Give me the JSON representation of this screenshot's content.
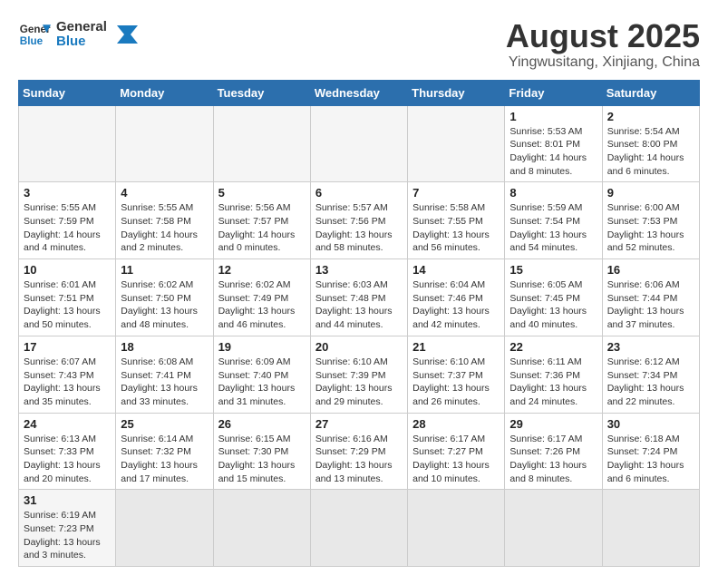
{
  "header": {
    "logo_text_general": "General",
    "logo_text_blue": "Blue",
    "month_title": "August 2025",
    "location": "Yingwusitang, Xinjiang, China"
  },
  "days_of_week": [
    "Sunday",
    "Monday",
    "Tuesday",
    "Wednesday",
    "Thursday",
    "Friday",
    "Saturday"
  ],
  "weeks": [
    {
      "days": [
        {
          "num": "",
          "info": ""
        },
        {
          "num": "",
          "info": ""
        },
        {
          "num": "",
          "info": ""
        },
        {
          "num": "",
          "info": ""
        },
        {
          "num": "",
          "info": ""
        },
        {
          "num": "1",
          "info": "Sunrise: 5:53 AM\nSunset: 8:01 PM\nDaylight: 14 hours and 8 minutes."
        },
        {
          "num": "2",
          "info": "Sunrise: 5:54 AM\nSunset: 8:00 PM\nDaylight: 14 hours and 6 minutes."
        }
      ]
    },
    {
      "days": [
        {
          "num": "3",
          "info": "Sunrise: 5:55 AM\nSunset: 7:59 PM\nDaylight: 14 hours and 4 minutes."
        },
        {
          "num": "4",
          "info": "Sunrise: 5:55 AM\nSunset: 7:58 PM\nDaylight: 14 hours and 2 minutes."
        },
        {
          "num": "5",
          "info": "Sunrise: 5:56 AM\nSunset: 7:57 PM\nDaylight: 14 hours and 0 minutes."
        },
        {
          "num": "6",
          "info": "Sunrise: 5:57 AM\nSunset: 7:56 PM\nDaylight: 13 hours and 58 minutes."
        },
        {
          "num": "7",
          "info": "Sunrise: 5:58 AM\nSunset: 7:55 PM\nDaylight: 13 hours and 56 minutes."
        },
        {
          "num": "8",
          "info": "Sunrise: 5:59 AM\nSunset: 7:54 PM\nDaylight: 13 hours and 54 minutes."
        },
        {
          "num": "9",
          "info": "Sunrise: 6:00 AM\nSunset: 7:53 PM\nDaylight: 13 hours and 52 minutes."
        }
      ]
    },
    {
      "days": [
        {
          "num": "10",
          "info": "Sunrise: 6:01 AM\nSunset: 7:51 PM\nDaylight: 13 hours and 50 minutes."
        },
        {
          "num": "11",
          "info": "Sunrise: 6:02 AM\nSunset: 7:50 PM\nDaylight: 13 hours and 48 minutes."
        },
        {
          "num": "12",
          "info": "Sunrise: 6:02 AM\nSunset: 7:49 PM\nDaylight: 13 hours and 46 minutes."
        },
        {
          "num": "13",
          "info": "Sunrise: 6:03 AM\nSunset: 7:48 PM\nDaylight: 13 hours and 44 minutes."
        },
        {
          "num": "14",
          "info": "Sunrise: 6:04 AM\nSunset: 7:46 PM\nDaylight: 13 hours and 42 minutes."
        },
        {
          "num": "15",
          "info": "Sunrise: 6:05 AM\nSunset: 7:45 PM\nDaylight: 13 hours and 40 minutes."
        },
        {
          "num": "16",
          "info": "Sunrise: 6:06 AM\nSunset: 7:44 PM\nDaylight: 13 hours and 37 minutes."
        }
      ]
    },
    {
      "days": [
        {
          "num": "17",
          "info": "Sunrise: 6:07 AM\nSunset: 7:43 PM\nDaylight: 13 hours and 35 minutes."
        },
        {
          "num": "18",
          "info": "Sunrise: 6:08 AM\nSunset: 7:41 PM\nDaylight: 13 hours and 33 minutes."
        },
        {
          "num": "19",
          "info": "Sunrise: 6:09 AM\nSunset: 7:40 PM\nDaylight: 13 hours and 31 minutes."
        },
        {
          "num": "20",
          "info": "Sunrise: 6:10 AM\nSunset: 7:39 PM\nDaylight: 13 hours and 29 minutes."
        },
        {
          "num": "21",
          "info": "Sunrise: 6:10 AM\nSunset: 7:37 PM\nDaylight: 13 hours and 26 minutes."
        },
        {
          "num": "22",
          "info": "Sunrise: 6:11 AM\nSunset: 7:36 PM\nDaylight: 13 hours and 24 minutes."
        },
        {
          "num": "23",
          "info": "Sunrise: 6:12 AM\nSunset: 7:34 PM\nDaylight: 13 hours and 22 minutes."
        }
      ]
    },
    {
      "days": [
        {
          "num": "24",
          "info": "Sunrise: 6:13 AM\nSunset: 7:33 PM\nDaylight: 13 hours and 20 minutes."
        },
        {
          "num": "25",
          "info": "Sunrise: 6:14 AM\nSunset: 7:32 PM\nDaylight: 13 hours and 17 minutes."
        },
        {
          "num": "26",
          "info": "Sunrise: 6:15 AM\nSunset: 7:30 PM\nDaylight: 13 hours and 15 minutes."
        },
        {
          "num": "27",
          "info": "Sunrise: 6:16 AM\nSunset: 7:29 PM\nDaylight: 13 hours and 13 minutes."
        },
        {
          "num": "28",
          "info": "Sunrise: 6:17 AM\nSunset: 7:27 PM\nDaylight: 13 hours and 10 minutes."
        },
        {
          "num": "29",
          "info": "Sunrise: 6:17 AM\nSunset: 7:26 PM\nDaylight: 13 hours and 8 minutes."
        },
        {
          "num": "30",
          "info": "Sunrise: 6:18 AM\nSunset: 7:24 PM\nDaylight: 13 hours and 6 minutes."
        }
      ]
    },
    {
      "days": [
        {
          "num": "31",
          "info": "Sunrise: 6:19 AM\nSunset: 7:23 PM\nDaylight: 13 hours and 3 minutes."
        },
        {
          "num": "",
          "info": ""
        },
        {
          "num": "",
          "info": ""
        },
        {
          "num": "",
          "info": ""
        },
        {
          "num": "",
          "info": ""
        },
        {
          "num": "",
          "info": ""
        },
        {
          "num": "",
          "info": ""
        }
      ]
    }
  ]
}
